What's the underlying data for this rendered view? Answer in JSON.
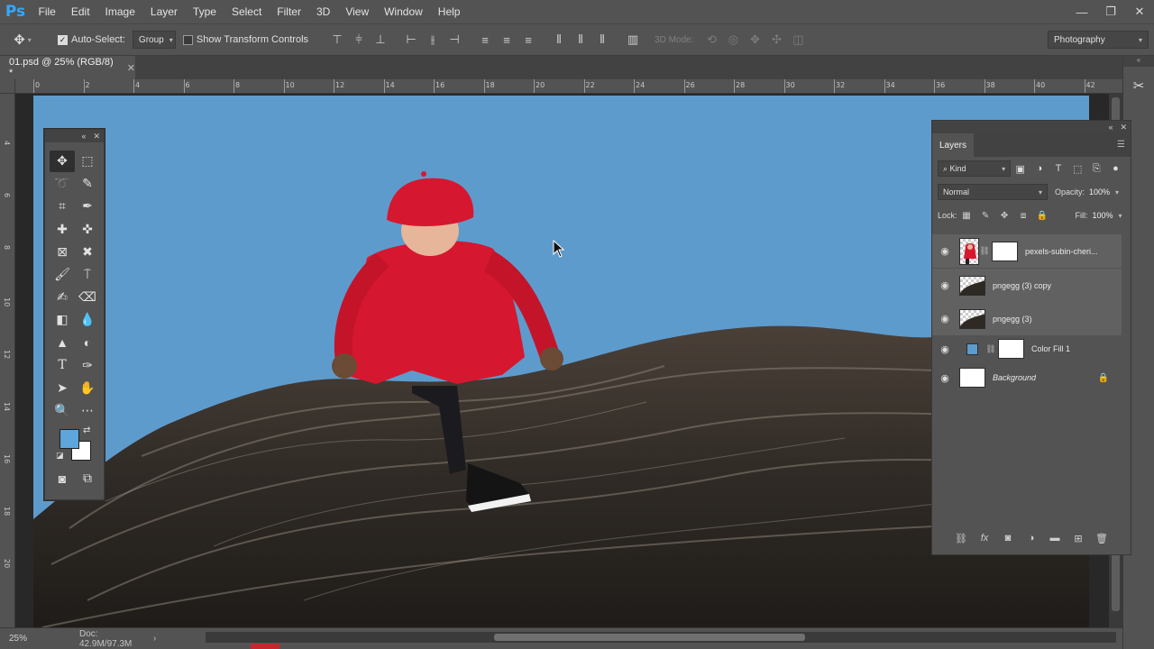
{
  "app": {
    "logo": "Ps"
  },
  "menu": [
    "File",
    "Edit",
    "Image",
    "Layer",
    "Type",
    "Select",
    "Filter",
    "3D",
    "View",
    "Window",
    "Help"
  ],
  "window_controls": {
    "minimize": "—",
    "restore": "❐",
    "close": "✕"
  },
  "options": {
    "tool_icon": "move-tool-icon",
    "auto_select_label": "Auto-Select:",
    "auto_select_value": "Group",
    "show_transform_label": "Show Transform Controls",
    "mode_3d_label": "3D Mode:",
    "workspace": "Photography"
  },
  "document": {
    "tab_title": "01.psd @ 25% (RGB/8) *",
    "zoom": "25%",
    "doc_info": "Doc: 42.9M/97.3M"
  },
  "ruler": {
    "top_ticks": [
      "0",
      "2",
      "4",
      "6",
      "8",
      "10",
      "12",
      "14",
      "16",
      "18",
      "20",
      "22",
      "24",
      "26",
      "28",
      "30",
      "32",
      "34",
      "36",
      "38",
      "40",
      "42"
    ],
    "left_ticks": [
      "4",
      "6",
      "8",
      "1\n0",
      "1\n2",
      "1\n4",
      "1\n6",
      "1\n8",
      "2\n0"
    ]
  },
  "colors": {
    "foreground": "#5ea5dc",
    "background": "#ffffff",
    "sky": "#5e9bcd",
    "accent": "#31a8ff"
  },
  "layers_panel": {
    "tab": "Layers",
    "filter_kind": "Kind",
    "blend_mode": "Normal",
    "opacity_label": "Opacity:",
    "opacity_value": "100%",
    "lock_label": "Lock:",
    "fill_label": "Fill:",
    "fill_value": "100%",
    "layers": [
      {
        "name": "pexels-subin-cheri...",
        "selected": true,
        "has_mask": true
      },
      {
        "name": "pngegg (3) copy",
        "selected": true,
        "has_mask": false
      },
      {
        "name": "pngegg (3)",
        "selected": true,
        "has_mask": false
      },
      {
        "name": "Color Fill 1",
        "selected": false,
        "has_mask": true
      },
      {
        "name": "Background",
        "selected": false,
        "has_mask": false,
        "locked": true
      }
    ]
  }
}
